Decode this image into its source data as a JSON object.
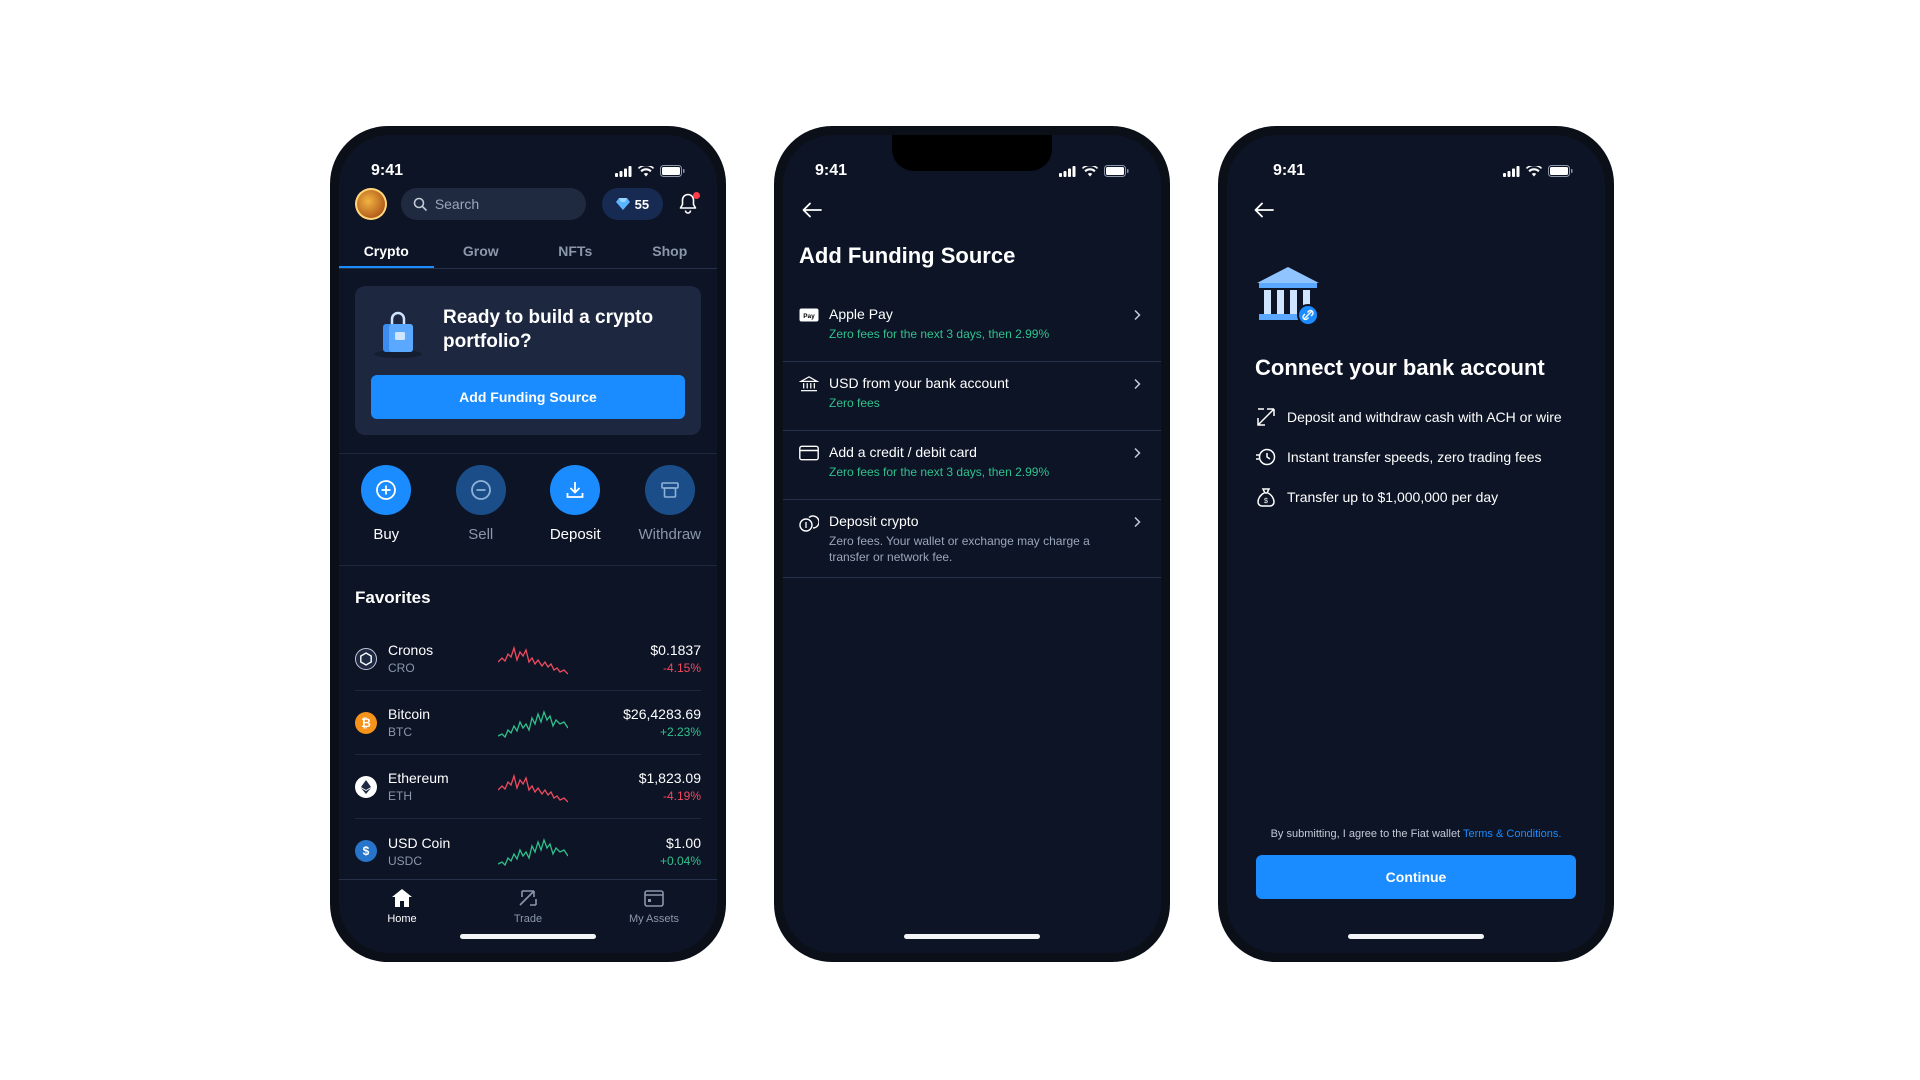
{
  "status": {
    "time": "9:41"
  },
  "home": {
    "search_placeholder": "Search",
    "gems_count": "55",
    "tabs": [
      {
        "label": "Crypto",
        "active": true
      },
      {
        "label": "Grow",
        "active": false
      },
      {
        "label": "NFTs",
        "active": false
      },
      {
        "label": "Shop",
        "active": false
      }
    ],
    "promo": {
      "text": "Ready to build a crypto portfolio?",
      "button": "Add Funding Source"
    },
    "actions": [
      {
        "label": "Buy",
        "icon": "plus-circle-icon",
        "enabled": true
      },
      {
        "label": "Sell",
        "icon": "minus-circle-icon",
        "enabled": false
      },
      {
        "label": "Deposit",
        "icon": "download-icon",
        "enabled": true
      },
      {
        "label": "Withdraw",
        "icon": "withdraw-icon",
        "enabled": false
      }
    ],
    "favorites_title": "Favorites",
    "favorites": [
      {
        "name": "Cronos",
        "symbol": "CRO",
        "price": "$0.1837",
        "change": "-4.15%",
        "trend": "down",
        "icon_color": "#1e2a44"
      },
      {
        "name": "Bitcoin",
        "symbol": "BTC",
        "price": "$26,4283.69",
        "change": "+2.23%",
        "trend": "up",
        "icon_color": "#f7931a"
      },
      {
        "name": "Ethereum",
        "symbol": "ETH",
        "price": "$1,823.09",
        "change": "-4.19%",
        "trend": "down",
        "icon_color": "#ffffff"
      },
      {
        "name": "USD Coin",
        "symbol": "USDC",
        "price": "$1.00",
        "change": "+0.04%",
        "trend": "up",
        "icon_color": "#2775ca"
      }
    ],
    "nav": [
      {
        "label": "Home",
        "icon": "home-icon",
        "active": true
      },
      {
        "label": "Trade",
        "icon": "trade-arrows-icon",
        "active": false
      },
      {
        "label": "My Assets",
        "icon": "wallet-icon",
        "active": false
      }
    ]
  },
  "funding": {
    "title": "Add Funding Source",
    "options": [
      {
        "label": "Apple Pay",
        "sub": "Zero fees for the next 3 days, then 2.99%",
        "icon": "apple-pay-icon"
      },
      {
        "label": "USD from your bank account",
        "sub": "Zero fees",
        "icon": "bank-icon"
      },
      {
        "label": "Add a credit / debit card",
        "sub": "Zero fees for the next 3 days, then 2.99%",
        "icon": "credit-card-icon"
      },
      {
        "label": "Deposit crypto",
        "sub": "Zero fees. Your wallet or exchange may charge a transfer or network fee.",
        "icon": "crypto-coins-icon"
      }
    ]
  },
  "connect": {
    "title": "Connect your bank account",
    "features": [
      {
        "text": "Deposit and withdraw cash with ACH or wire",
        "icon": "transfer-arrows-icon"
      },
      {
        "text": "Instant transfer speeds, zero trading fees",
        "icon": "fast-clock-icon"
      },
      {
        "text": "Transfer up to $1,000,000 per day",
        "icon": "money-bag-icon"
      }
    ],
    "terms_prefix": "By submitting, I agree to the Fiat wallet ",
    "terms_link": "Terms & Conditions.",
    "button": "Continue"
  },
  "colors": {
    "accent": "#1a8cff",
    "background": "#0d1426",
    "positive": "#2fc28d",
    "negative": "#f04a5e"
  }
}
